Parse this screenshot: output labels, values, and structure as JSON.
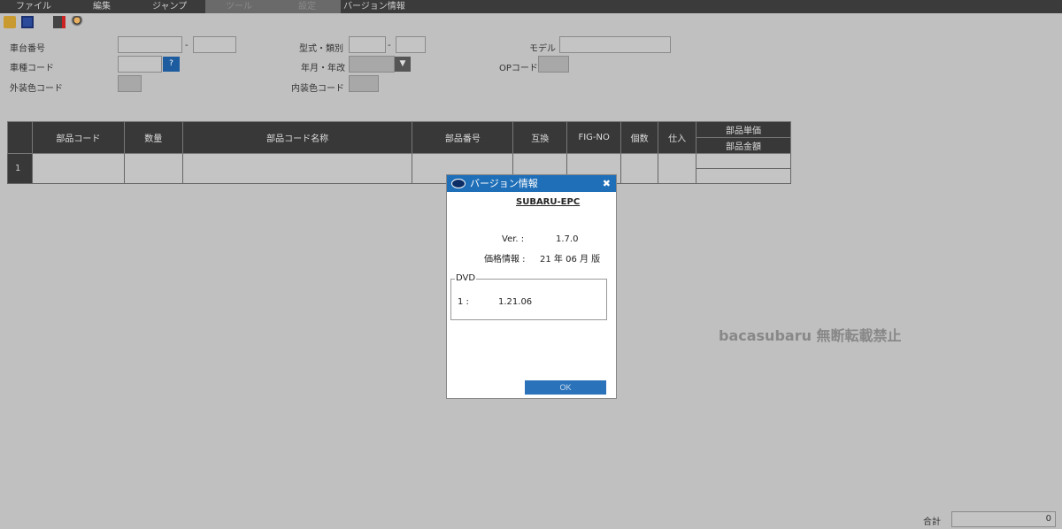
{
  "menu": [
    "ファイル",
    "編集",
    "ジャンプ",
    "ツール",
    "設定",
    "バージョン情報"
  ],
  "form": {
    "chassis": "車台番号",
    "model_type": "型式・類別",
    "model": "モデル",
    "car_code": "車種コード",
    "help": "?",
    "year": "年月・年改",
    "op_code": "OPコード",
    "ext_color": "外装色コード",
    "int_color": "内装色コード",
    "dash": "-"
  },
  "table": {
    "headers": [
      "部品コード",
      "数量",
      "部品コード名称",
      "部品番号",
      "互換",
      "FIG-NO",
      "個数",
      "仕入",
      "部品単価",
      "部品金額"
    ],
    "row_number": "1"
  },
  "dialog": {
    "title": "バージョン情報",
    "product": "SUBARU-EPC",
    "ver_label": "Ver. :",
    "ver": "1.7.0",
    "price_label": "価格情報 :",
    "price": "21 年 06 月 版",
    "dvd_label": "DVD",
    "dvd_line_label": "1 :",
    "dvd_ver": "1.21.06",
    "ok": "OK"
  },
  "watermark": "bacasubaru 無断転載禁止",
  "total": {
    "label": "合計",
    "value": "0"
  }
}
